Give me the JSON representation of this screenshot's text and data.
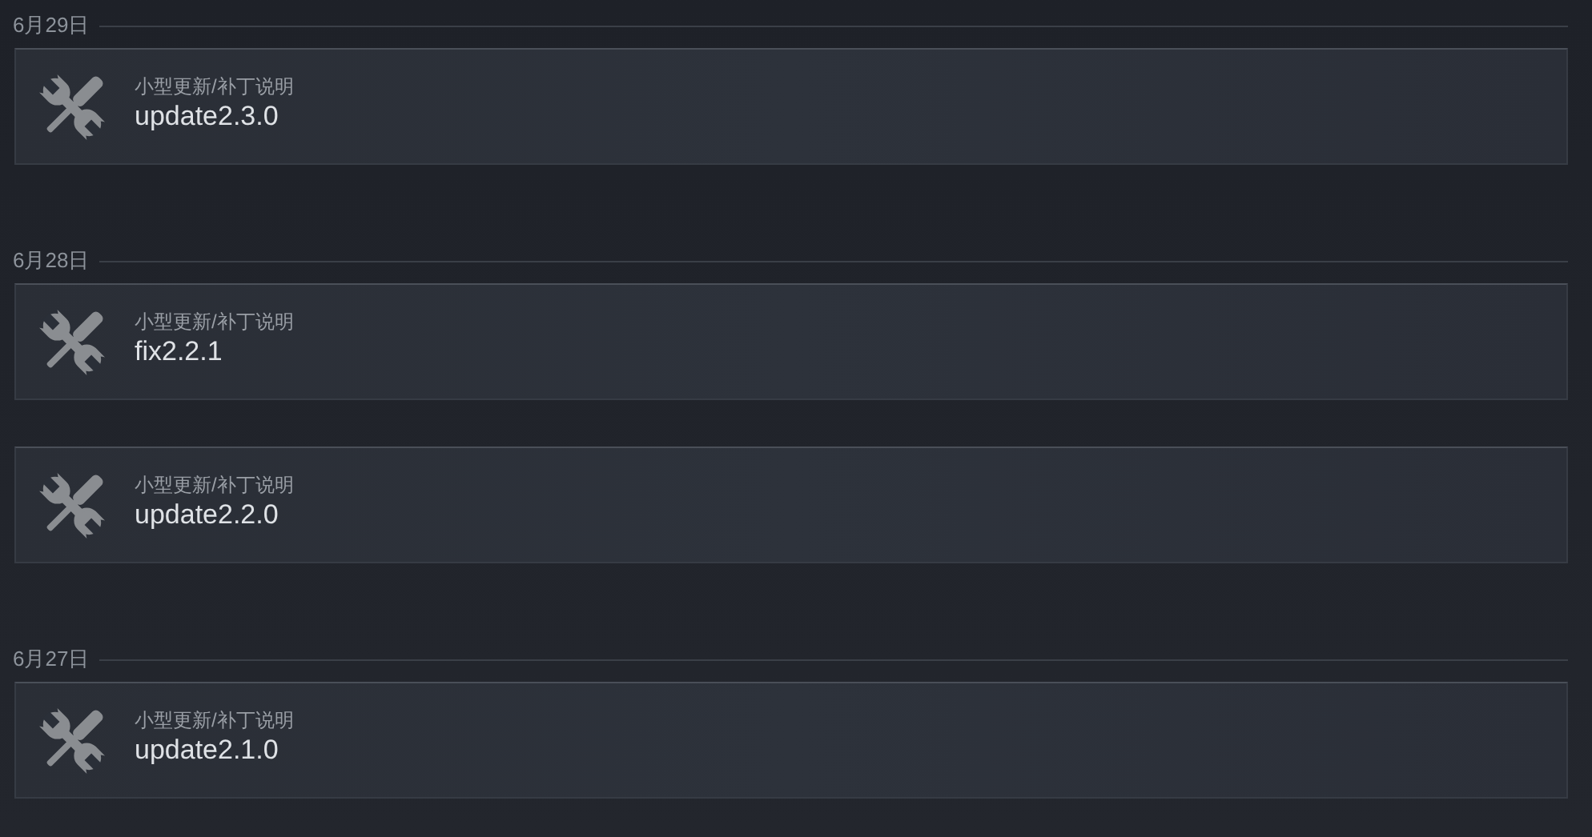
{
  "groups": [
    {
      "date": "6月29日",
      "entries": [
        {
          "category": "小型更新/补丁说明",
          "title": "update2.3.0"
        }
      ]
    },
    {
      "date": "6月28日",
      "entries": [
        {
          "category": "小型更新/补丁说明",
          "title": "fix2.2.1"
        },
        {
          "category": "小型更新/补丁说明",
          "title": "update2.2.0"
        }
      ]
    },
    {
      "date": "6月27日",
      "entries": [
        {
          "category": "小型更新/补丁说明",
          "title": "update2.1.0"
        }
      ]
    }
  ]
}
